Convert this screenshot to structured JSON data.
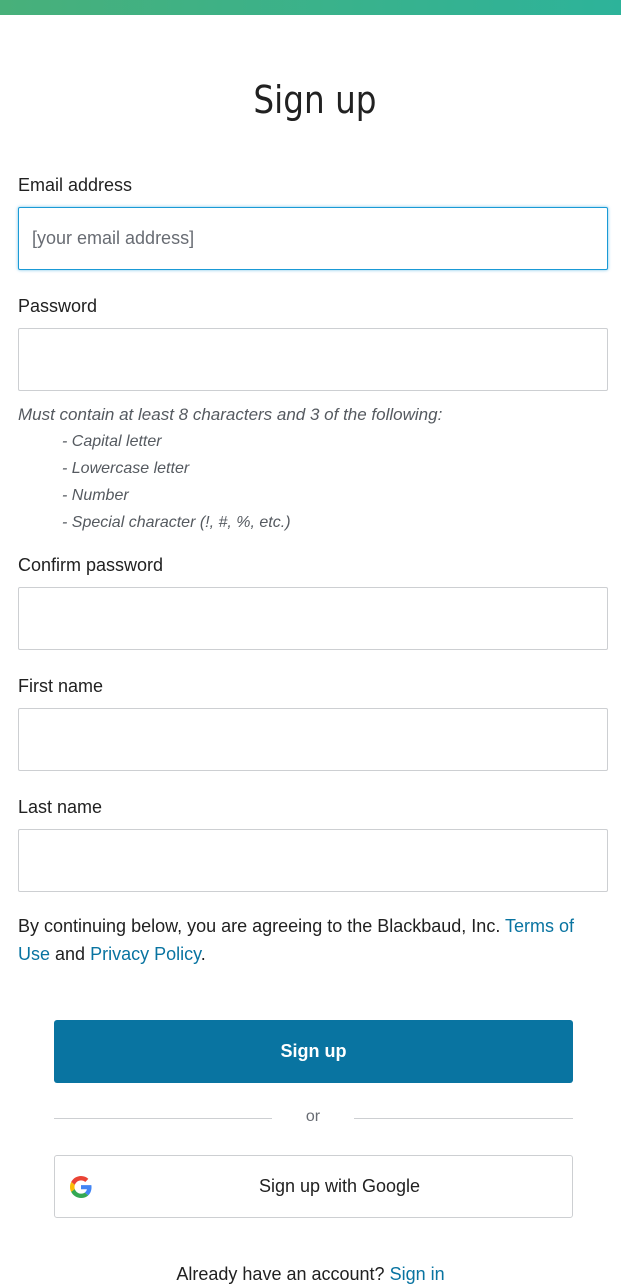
{
  "header": {
    "title": "Sign up"
  },
  "form": {
    "email_label": "Email address",
    "email_placeholder": "[your email address]",
    "password_label": "Password",
    "password_hint": "Must contain at least 8 characters and 3 of the following:",
    "password_rules": [
      "- Capital letter",
      "- Lowercase letter",
      "- Number",
      "- Special character (!, #, %, etc.)"
    ],
    "confirm_label": "Confirm password",
    "first_name_label": "First name",
    "last_name_label": "Last name"
  },
  "terms": {
    "prefix": "By continuing below, you are agreeing to the Blackbaud, Inc.",
    "terms_link": "Terms of Use",
    "and": "and",
    "privacy_link": "Privacy Policy",
    "suffix": "."
  },
  "actions": {
    "signup_label": "Sign up",
    "or_text": "or",
    "google_label": "Sign up with Google",
    "google_icon": "google-icon"
  },
  "footer": {
    "prompt": "Already have an account?",
    "signin_link": "Sign in"
  },
  "colors": {
    "accent_bar_start": "#48b07a",
    "accent_bar_end": "#2db39a",
    "primary": "#0974a1",
    "link": "#0974a1",
    "focus": "#1a9ad6"
  }
}
